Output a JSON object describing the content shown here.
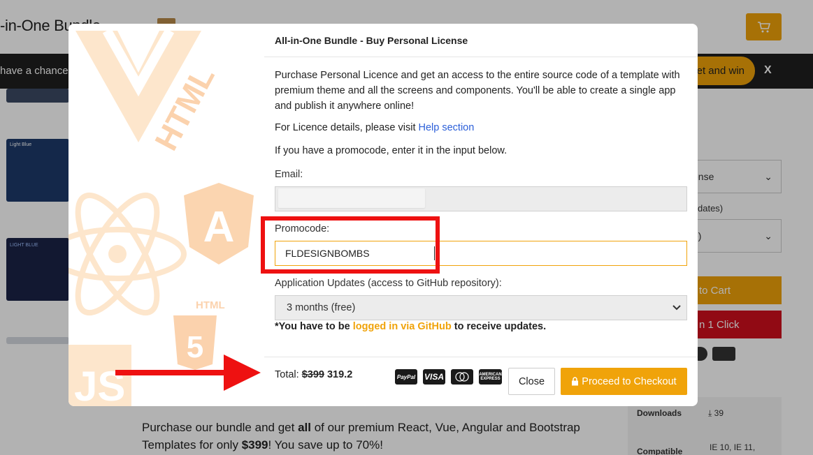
{
  "background": {
    "page_title": "-in-One Bundle",
    "promo_bar_text": "have a chance",
    "promo_bar_button": "et and win",
    "promo_bar_close": "X",
    "thumb_labels": [
      "Light Blue",
      "LIGHT BLUE"
    ],
    "license_select": "ense",
    "updates_label": "dates)",
    "updates_select": "e)",
    "add_to_cart": "to Cart",
    "buy_one_click": "n 1 Click",
    "info": {
      "downloads_label": "Downloads",
      "downloads_value": "39",
      "compatible_label": "Compatible",
      "compatible_value": "IE 10, IE 11,"
    },
    "bottom_paragraph_parts": {
      "p1": "Purchase our bundle and get ",
      "b1": "all",
      "p2": " of our premium React, Vue, Angular and Bootstrap Templates for only ",
      "b2": "$399",
      "p3": "! You save up to 70%!"
    }
  },
  "modal": {
    "title": "All-in-One Bundle - Buy Personal License",
    "description": "Purchase Personal Licence and get an access to the entire source code of a template with premium theme and all the screens and components. You'll be able to create a single app and publish it anywhere online!",
    "licence_prefix": "For Licence details, please visit ",
    "licence_link": "Help section",
    "promo_hint": "If you have a promocode, enter it in the input below.",
    "email_label": "Email:",
    "email_value": "",
    "promocode_label": "Promocode:",
    "promocode_value": "FLDESIGNBOMBS",
    "updates_label": "Application Updates (access to GitHub repository):",
    "updates_value": "3 months (free)",
    "github_prefix": "*You have to be ",
    "github_link": "logged in via GitHub",
    "github_suffix": " to receive updates.",
    "total_label": "Total: ",
    "total_old": "$399",
    "total_new": " 319.2",
    "payment_icons": [
      "PayPal",
      "VISA",
      "MasterCard",
      "AMERICAN EXPRESS"
    ],
    "close_label": "Close",
    "checkout_label": "Proceed to Checkout"
  },
  "art_labels": {
    "html_vertical": "HTML",
    "html_small": "HTML",
    "js": "JS",
    "angular": "A",
    "html5": "5"
  },
  "colors": {
    "accent": "#f0a30a",
    "annotation_red": "#ee1111",
    "link_blue": "#2b5fd9"
  }
}
